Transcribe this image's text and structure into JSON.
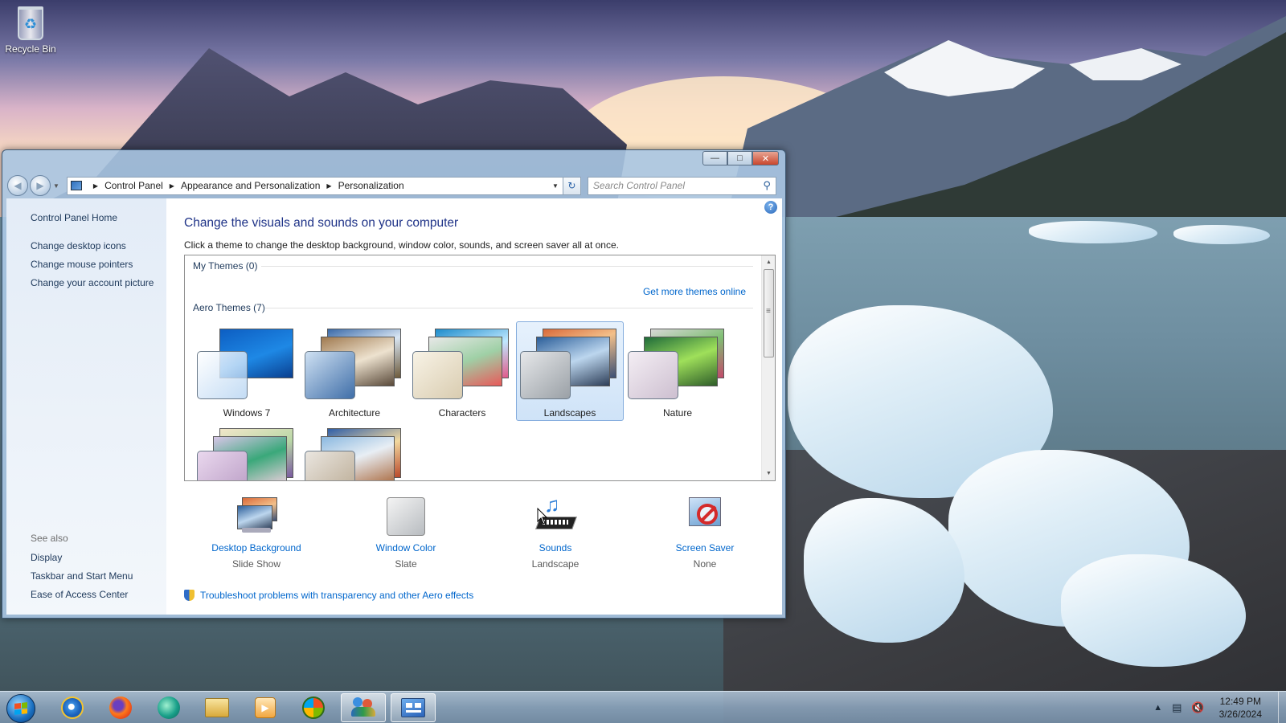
{
  "desktop": {
    "recycle_bin_label": "Recycle Bin"
  },
  "window": {
    "nav": {
      "breadcrumbs": [
        "Control Panel",
        "Appearance and Personalization",
        "Personalization"
      ],
      "search_placeholder": "Search Control Panel"
    },
    "left_pane": {
      "links": [
        "Control Panel Home",
        "Change desktop icons",
        "Change mouse pointers",
        "Change your account picture"
      ],
      "see_also_heading": "See also",
      "see_also_links": [
        "Display",
        "Taskbar and Start Menu",
        "Ease of Access Center"
      ]
    },
    "main": {
      "title": "Change the visuals and sounds on your computer",
      "subtitle": "Click a theme to change the desktop background, window color, sounds, and screen saver all at once.",
      "my_themes_heading": "My Themes (0)",
      "get_more_link": "Get more themes online",
      "aero_heading": "Aero Themes (7)",
      "themes": [
        {
          "name": "Windows 7",
          "selected": false
        },
        {
          "name": "Architecture",
          "selected": false
        },
        {
          "name": "Characters",
          "selected": false
        },
        {
          "name": "Landscapes",
          "selected": true
        },
        {
          "name": "Nature",
          "selected": false
        },
        {
          "name": "",
          "selected": false
        },
        {
          "name": "",
          "selected": false
        }
      ],
      "settings": [
        {
          "label": "Desktop Background",
          "value": "Slide Show",
          "icon": "desktop-background-icon"
        },
        {
          "label": "Window Color",
          "value": "Slate",
          "icon": "window-color-icon"
        },
        {
          "label": "Sounds",
          "value": "Landscape",
          "icon": "sounds-icon"
        },
        {
          "label": "Screen Saver",
          "value": "None",
          "icon": "screen-saver-icon"
        }
      ],
      "troubleshoot_link": "Troubleshoot problems with transparency and other Aero effects"
    }
  },
  "taskbar": {
    "pinned_icons": [
      "internet-explorer-icon",
      "firefox-icon",
      "browser-icon",
      "windows-explorer-icon",
      "media-player-icon",
      "windows-logo-icon",
      "users-icon",
      "control-panel-icon"
    ],
    "clock_time": "12:49 PM",
    "clock_date": "3/26/2024"
  },
  "colors": {
    "link": "#0066cc",
    "title": "#1e3287",
    "selection": "#cfe3f8"
  }
}
